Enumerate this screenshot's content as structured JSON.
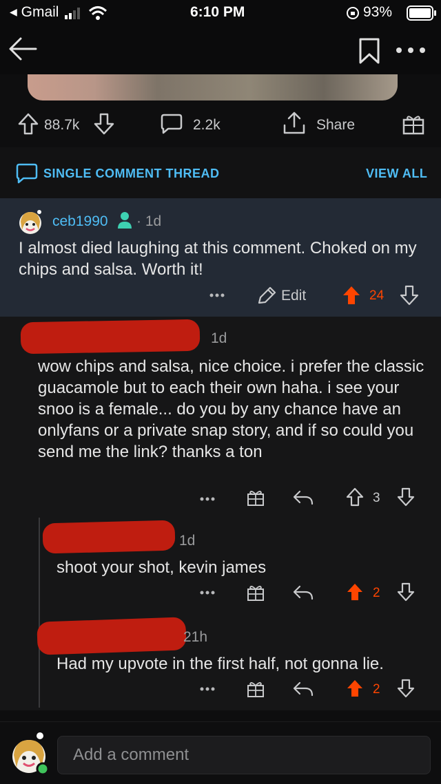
{
  "status_bar": {
    "back_app": "Gmail",
    "time": "6:10 PM",
    "battery": "93%"
  },
  "post_actions": {
    "upvotes": "88.7k",
    "comments": "2.2k",
    "share_label": "Share"
  },
  "thread_bar": {
    "title": "SINGLE COMMENT THREAD",
    "view_all": "VIEW ALL"
  },
  "op_comment": {
    "username": "ceb1990",
    "age": "1d",
    "body": "I almost died laughing at this comment. Choked on my chips and salsa. Worth it!",
    "edit_label": "Edit",
    "score": "24",
    "voted": "up"
  },
  "comments": [
    {
      "age": "1d",
      "body": "wow chips and salsa, nice choice. i prefer the classic guacamole but to each their own haha. i see your snoo is a female... do you by any chance have an onlyfans or a private snap story, and if so could you send me the link? thanks a ton",
      "score": "3",
      "voted": "none"
    },
    {
      "age": "1d",
      "body": "shoot your shot, kevin james",
      "score": "2",
      "voted": "up"
    },
    {
      "age": "21h",
      "body": "Had my upvote in the first half, not gonna lie.",
      "score": "2",
      "voted": "up"
    }
  ],
  "composer": {
    "placeholder": "Add a comment"
  },
  "colors": {
    "accent_blue": "#4fbdf5",
    "upvote_orange": "#ff4500",
    "op_background": "#232a35",
    "redaction_red": "#c81e10"
  },
  "icons": [
    "back-arrow-icon",
    "bookmark-icon",
    "more-icon",
    "upvote-icon",
    "downvote-icon",
    "comment-icon",
    "share-icon",
    "award-icon",
    "edit-icon",
    "reply-icon",
    "user-icon"
  ]
}
